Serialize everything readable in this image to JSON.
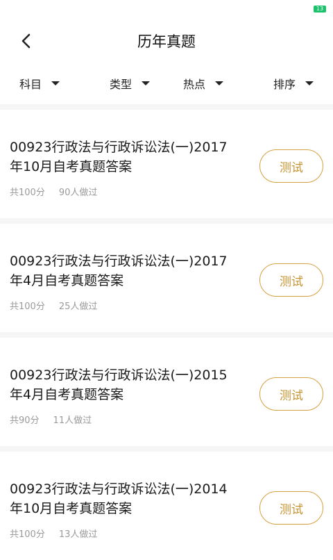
{
  "status_bar": {
    "battery": "13"
  },
  "header": {
    "title": "历年真题",
    "back_icon": "chevron-left-icon"
  },
  "filters": [
    {
      "label": "科目",
      "icon": "caret-down-icon"
    },
    {
      "label": "类型",
      "icon": "caret-down-icon"
    },
    {
      "label": "热点",
      "icon": "caret-down-icon"
    },
    {
      "label": "排序",
      "icon": "caret-down-icon"
    }
  ],
  "items": [
    {
      "title": "00923行政法与行政诉讼法(一)2017年10月自考真题答案",
      "score": "共100分",
      "count": "90人做过",
      "button": "测试"
    },
    {
      "title": "00923行政法与行政诉讼法(一)2017年4月自考真题答案",
      "score": "共100分",
      "count": "25人做过",
      "button": "测试"
    },
    {
      "title": "00923行政法与行政诉讼法(一)2015年4月自考真题答案",
      "score": "共90分",
      "count": "11人做过",
      "button": "测试"
    },
    {
      "title": "00923行政法与行政诉讼法(一)2014年10月自考真题答案",
      "score": "共100分",
      "count": "13人做过",
      "button": "测试"
    }
  ],
  "colors": {
    "accent": "#c89432",
    "battery": "#1cc26b"
  }
}
